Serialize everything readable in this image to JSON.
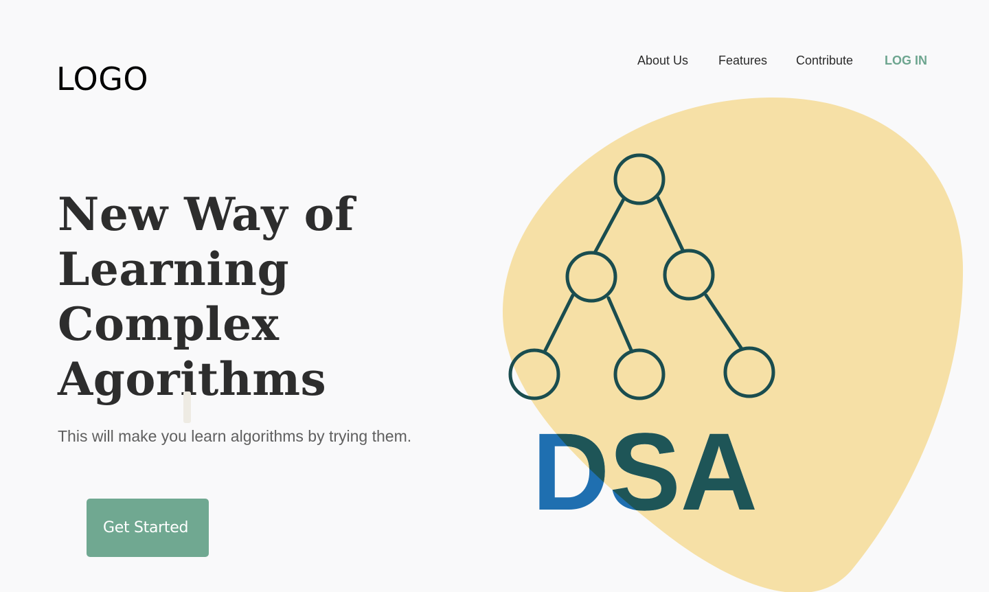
{
  "header": {
    "logo_text": "LOGO",
    "nav": [
      {
        "label": "About Us"
      },
      {
        "label": "Features"
      },
      {
        "label": "Contribute"
      },
      {
        "label": "LOG IN"
      }
    ]
  },
  "hero": {
    "headline_lines": [
      "New Way of",
      "Learning",
      "Complex",
      "Agorithms"
    ],
    "subtitle": "This will make you learn algorithms by trying them.",
    "cta_label": "Get Started",
    "illustration": {
      "blob_color": "#f6e0a6",
      "tree_color": "#1a4d4f",
      "dsa_text": "DSA",
      "dsa_left_color": "#1f6fb0",
      "dsa_right_color": "#1e5557"
    }
  },
  "colors": {
    "background": "#f9f9fa",
    "accent": "#6da58f",
    "heading": "#2d2d2d"
  }
}
